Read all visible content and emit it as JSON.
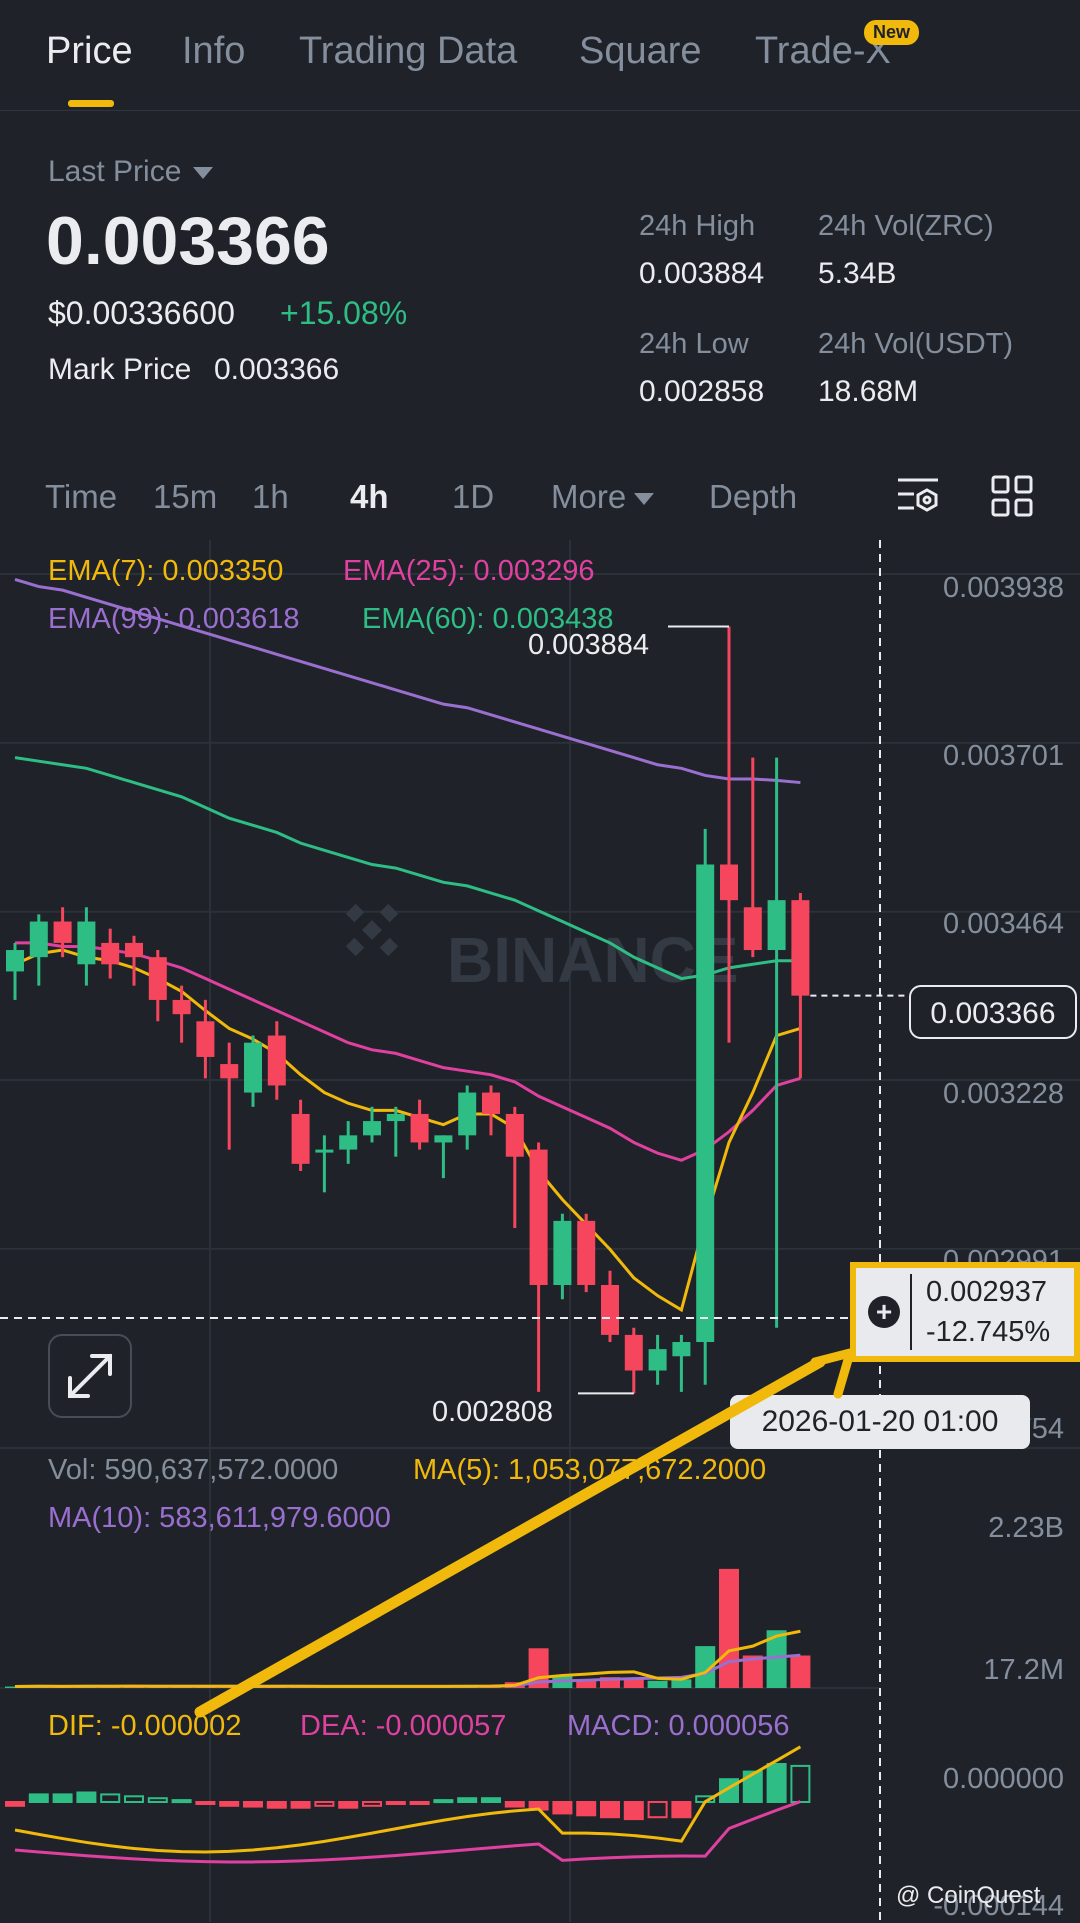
{
  "tabs": [
    {
      "label": "Price",
      "active": true
    },
    {
      "label": "Info",
      "active": false
    },
    {
      "label": "Trading Data",
      "active": false
    },
    {
      "label": "Square",
      "active": false
    },
    {
      "label": "Trade-X",
      "active": false
    }
  ],
  "new_badge": "New",
  "summary": {
    "last_price_label": "Last Price",
    "last_price": "0.003366",
    "usd_price": "$0.00336600",
    "change_pct": "+15.08%",
    "mark_price_label": "Mark Price",
    "mark_price": "0.003366",
    "high_label": "24h High",
    "high": "0.003884",
    "vol_zrc_label": "24h Vol(ZRC)",
    "vol_zrc": "5.34B",
    "low_label": "24h Low",
    "low": "0.002858",
    "vol_usdt_label": "24h Vol(USDT)",
    "vol_usdt": "18.68M"
  },
  "intervals": {
    "time": "Time",
    "m15": "15m",
    "h1": "1h",
    "h4": "4h",
    "d1": "1D",
    "more": "More",
    "depth": "Depth",
    "active": "4h"
  },
  "icons": {
    "indicator": "indicator-settings-icon",
    "layout": "grid-layout-icon",
    "expand": "expand-icon",
    "crosshair": "crosshair-plus-icon"
  },
  "colors": {
    "up": "#2ebd85",
    "down": "#f6465d",
    "accent": "#f0b90b",
    "ema7": "#f0b90b",
    "ema25": "#e040a0",
    "ema99": "#9b6fd0",
    "ema60": "#2ebd85"
  },
  "indicators": {
    "ema7": "EMA(7): 0.003350",
    "ema25": "EMA(25): 0.003296",
    "ema99": "EMA(99): 0.003618",
    "ema60": "EMA(60): 0.003438",
    "vol": "Vol: 590,637,572.0000",
    "ma5": "MA(5): 1,053,077,672.2000",
    "ma10": "MA(10): 583,611,979.6000",
    "dif": "DIF: -0.000002",
    "dea": "DEA: -0.000057",
    "macd": "MACD: 0.000056"
  },
  "price_axis": [
    "0.003938",
    "0.003701",
    "0.003464",
    "0.003228",
    "0.002991",
    "0.002754"
  ],
  "volume_axis": [
    "2.23B",
    "17.2M"
  ],
  "macd_axis": [
    "0.000000",
    "-0.000144"
  ],
  "high_marker": "0.003884",
  "low_marker": "0.002808",
  "current_price_tag": "0.003366",
  "crosshair": {
    "price": "0.002937",
    "pct": "-12.745%",
    "time": "2026-01-20 01:00"
  },
  "watermark": "BINANCE",
  "credit": "@ CoinQuest",
  "chart_data": {
    "type": "candlestick",
    "price_range": [
      0.00265,
      0.004
    ],
    "candles": [
      {
        "o": 0.0034,
        "h": 0.00344,
        "l": 0.00336,
        "c": 0.00343
      },
      {
        "o": 0.00342,
        "h": 0.00348,
        "l": 0.00338,
        "c": 0.00347
      },
      {
        "o": 0.00347,
        "h": 0.00349,
        "l": 0.00342,
        "c": 0.00344
      },
      {
        "o": 0.00341,
        "h": 0.00349,
        "l": 0.00338,
        "c": 0.00347
      },
      {
        "o": 0.00344,
        "h": 0.00346,
        "l": 0.00339,
        "c": 0.00341
      },
      {
        "o": 0.00344,
        "h": 0.00345,
        "l": 0.00338,
        "c": 0.00342
      },
      {
        "o": 0.00342,
        "h": 0.00343,
        "l": 0.00333,
        "c": 0.00336
      },
      {
        "o": 0.00336,
        "h": 0.00338,
        "l": 0.0033,
        "c": 0.00334
      },
      {
        "o": 0.00333,
        "h": 0.00336,
        "l": 0.00325,
        "c": 0.00328
      },
      {
        "o": 0.00327,
        "h": 0.0033,
        "l": 0.00315,
        "c": 0.00325
      },
      {
        "o": 0.00323,
        "h": 0.00331,
        "l": 0.00321,
        "c": 0.0033
      },
      {
        "o": 0.00331,
        "h": 0.00333,
        "l": 0.00322,
        "c": 0.00324
      },
      {
        "o": 0.0032,
        "h": 0.00322,
        "l": 0.00312,
        "c": 0.00313
      },
      {
        "o": 0.00315,
        "h": 0.00317,
        "l": 0.00309,
        "c": 0.00315
      },
      {
        "o": 0.00315,
        "h": 0.00319,
        "l": 0.00313,
        "c": 0.00317
      },
      {
        "o": 0.00317,
        "h": 0.00321,
        "l": 0.00316,
        "c": 0.00319
      },
      {
        "o": 0.00319,
        "h": 0.00321,
        "l": 0.00314,
        "c": 0.0032
      },
      {
        "o": 0.0032,
        "h": 0.00322,
        "l": 0.00315,
        "c": 0.00316
      },
      {
        "o": 0.00316,
        "h": 0.00317,
        "l": 0.00311,
        "c": 0.00317
      },
      {
        "o": 0.00317,
        "h": 0.00324,
        "l": 0.00315,
        "c": 0.00323
      },
      {
        "o": 0.00323,
        "h": 0.00324,
        "l": 0.00317,
        "c": 0.0032
      },
      {
        "o": 0.0032,
        "h": 0.00321,
        "l": 0.00304,
        "c": 0.00314
      },
      {
        "o": 0.00315,
        "h": 0.00316,
        "l": 0.00281,
        "c": 0.00296
      },
      {
        "o": 0.00296,
        "h": 0.00306,
        "l": 0.00294,
        "c": 0.00305
      },
      {
        "o": 0.00305,
        "h": 0.00306,
        "l": 0.00295,
        "c": 0.00296
      },
      {
        "o": 0.00296,
        "h": 0.00298,
        "l": 0.00288,
        "c": 0.00289
      },
      {
        "o": 0.00289,
        "h": 0.0029,
        "l": 0.002808,
        "c": 0.00284
      },
      {
        "o": 0.00284,
        "h": 0.00289,
        "l": 0.00282,
        "c": 0.00287
      },
      {
        "o": 0.00286,
        "h": 0.00289,
        "l": 0.00281,
        "c": 0.00288
      },
      {
        "o": 0.00288,
        "h": 0.0036,
        "l": 0.00282,
        "c": 0.00355
      },
      {
        "o": 0.00355,
        "h": 0.003884,
        "l": 0.0033,
        "c": 0.0035
      },
      {
        "o": 0.00349,
        "h": 0.0037,
        "l": 0.00342,
        "c": 0.00343
      },
      {
        "o": 0.00343,
        "h": 0.0037,
        "l": 0.0029,
        "c": 0.0035
      },
      {
        "o": 0.0035,
        "h": 0.00351,
        "l": 0.00325,
        "c": 0.003366
      }
    ],
    "ema7": [
      0.00341,
      0.003425,
      0.00343,
      0.00342,
      0.003415,
      0.003405,
      0.00339,
      0.003372,
      0.003345,
      0.00332,
      0.003305,
      0.003285,
      0.003255,
      0.00323,
      0.003215,
      0.003205,
      0.003205,
      0.003195,
      0.003185,
      0.0032,
      0.0032,
      0.00318,
      0.00312,
      0.00308,
      0.003045,
      0.00301,
      0.00297,
      0.002945,
      0.002925,
      0.00305,
      0.00316,
      0.00323,
      0.00331,
      0.00332
    ],
    "ema25": [
      0.00344,
      0.00344,
      0.003435,
      0.003435,
      0.00343,
      0.003425,
      0.003415,
      0.003405,
      0.00339,
      0.003375,
      0.00336,
      0.003345,
      0.00333,
      0.003315,
      0.0033,
      0.00329,
      0.003285,
      0.003275,
      0.003265,
      0.00326,
      0.003255,
      0.003245,
      0.003225,
      0.00321,
      0.003195,
      0.00318,
      0.00316,
      0.003145,
      0.003135,
      0.00315,
      0.003175,
      0.003205,
      0.00324,
      0.00325
    ],
    "ema60": [
      0.0037,
      0.003695,
      0.00369,
      0.003685,
      0.003675,
      0.003665,
      0.003655,
      0.003645,
      0.00363,
      0.003615,
      0.003605,
      0.003595,
      0.00358,
      0.00357,
      0.00356,
      0.00355,
      0.003545,
      0.003535,
      0.003525,
      0.00352,
      0.00351,
      0.0035,
      0.003485,
      0.00347,
      0.003455,
      0.00344,
      0.00342,
      0.003405,
      0.00339,
      0.003395,
      0.003405,
      0.00341,
      0.003415,
      0.003415
    ],
    "ema99": [
      0.00395,
      0.00394,
      0.003935,
      0.003925,
      0.003915,
      0.003905,
      0.003895,
      0.003885,
      0.003875,
      0.003865,
      0.003855,
      0.003845,
      0.003835,
      0.003825,
      0.003815,
      0.003805,
      0.003795,
      0.003785,
      0.003775,
      0.00377,
      0.00376,
      0.00375,
      0.00374,
      0.00373,
      0.00372,
      0.00371,
      0.0037,
      0.00369,
      0.003685,
      0.003675,
      0.00367,
      0.00367,
      0.003668,
      0.003665
    ],
    "volumes": [
      0.02,
      0.03,
      0.02,
      0.03,
      0.02,
      0.03,
      0.02,
      0.02,
      0.03,
      0.02,
      0.02,
      0.03,
      0.02,
      0.02,
      0.02,
      0.02,
      0.03,
      0.02,
      0.02,
      0.03,
      0.03,
      0.08,
      0.55,
      0.18,
      0.12,
      0.15,
      0.12,
      0.1,
      0.12,
      0.58,
      1.65,
      0.45,
      0.8,
      0.45
    ],
    "macd": [
      -0.1,
      0.2,
      0.2,
      0.25,
      0.2,
      0.15,
      0.1,
      0.05,
      -0.05,
      -0.1,
      -0.12,
      -0.15,
      -0.15,
      -0.1,
      -0.15,
      -0.1,
      -0.05,
      -0.05,
      0.05,
      0.1,
      0.1,
      -0.12,
      -0.2,
      -0.3,
      -0.35,
      -0.4,
      -0.45,
      -0.4,
      -0.4,
      0.15,
      0.6,
      0.8,
      1.0,
      0.95
    ]
  }
}
